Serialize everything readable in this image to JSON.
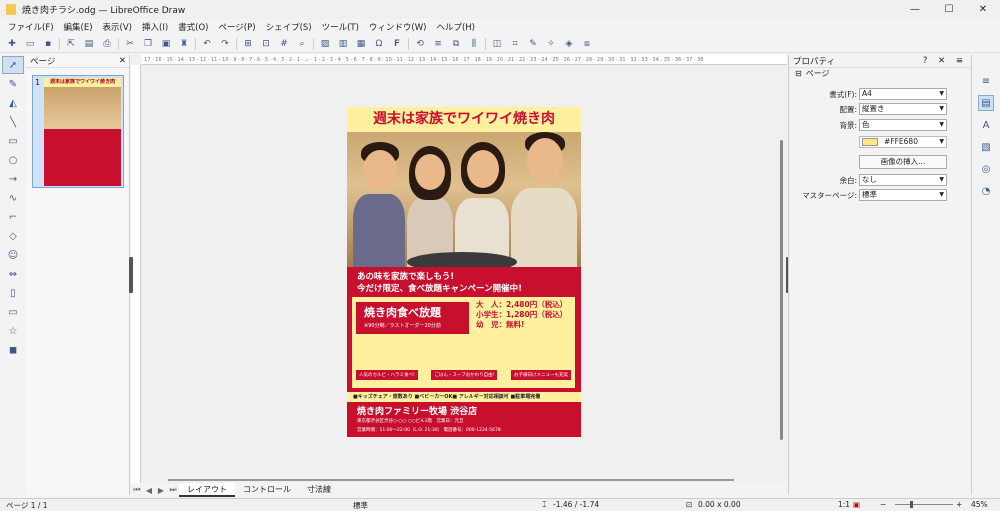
{
  "window": {
    "title": "焼き肉チラシ.odg — LibreOffice Draw",
    "controls": [
      "—",
      "☐",
      "✕"
    ]
  },
  "menu": [
    "ファイル(F)",
    "編集(E)",
    "表示(V)",
    "挿入(I)",
    "書式(O)",
    "ページ(P)",
    "シェイプ(S)",
    "ツール(T)",
    "ウィンドウ(W)",
    "ヘルプ(H)"
  ],
  "pages_pane": {
    "title": "ページ",
    "close": "✕",
    "thumb_number": "1"
  },
  "properties": {
    "title": "プロパティ",
    "section": "ページ",
    "format_label": "書式(F):",
    "format_value": "A4",
    "orientation_label": "配置:",
    "orientation_value": "縦置き",
    "background_label": "背景:",
    "background_value": "色",
    "color_value": "#FFE680",
    "insert_image_label": "画像の挿入...",
    "margin_label": "余白:",
    "margin_value": "なし",
    "master_label": "マスターページ:",
    "master_value": "標準"
  },
  "flyer": {
    "title": "週末は家族でワイワイ焼き肉",
    "line1": "あの味を家族で楽しもう!",
    "line2": "今だけ限定、食べ放題キャンペーン開催中!",
    "badge_title": "焼き肉食べ放題",
    "badge_sub": "※90分制／ラストオーダー20分前",
    "price_adult": "大　人：2,480円（税込）",
    "price_child": "小学生：1,280円（税込）",
    "price_infant": "幼　児：無料!",
    "chips": [
      "人気のカルビ・ハラミ食べ!",
      "ごはん・スープおかわり自由!",
      "お子様向けメニューも充実"
    ],
    "strip": "■キッズチェア・席数あり ■ベビーカーOK■ アレルギー対応相談可 ■駐車場完備",
    "store": "焼き肉ファミリー牧場 渋谷店",
    "address": "東京都渋谷区渋谷○-○○ ○○ビル1階　営業日：元旦",
    "hours": "営業時間：11:00〜22:00（L.O. 21:30） 電話番号：000-1234-5678"
  },
  "tabs": [
    "レイアウト",
    "コントロール",
    "寸法線"
  ],
  "status": {
    "page": "ページ 1 / 1",
    "master": "標準",
    "position": "-1.46 / -1.74",
    "size": "0.00 x 0.00",
    "scale": "1:1",
    "zoom": "45%"
  },
  "ruler_text": "· 17 · 16 · 15 · 14 · 13 · 12 · 11 · 10 · 9 · 8 · 7 · 6 · 5 · 4 · 3 · 2 · 1 · ⊥ · 1 · 2 · 3 · 4 · 5 · 6 · 7 · 8 · 9 · 10 · 11 · 12 · 13 · 14 · 15 · 16 · 17 · 18 · 19 · 20 · 21 · 22 · 23 · 24 · 25 · 26 · 27 · 28 · 29 · 30 · 31 · 32 · 33 · 34 · 35 · 36 · 37 · 38"
}
